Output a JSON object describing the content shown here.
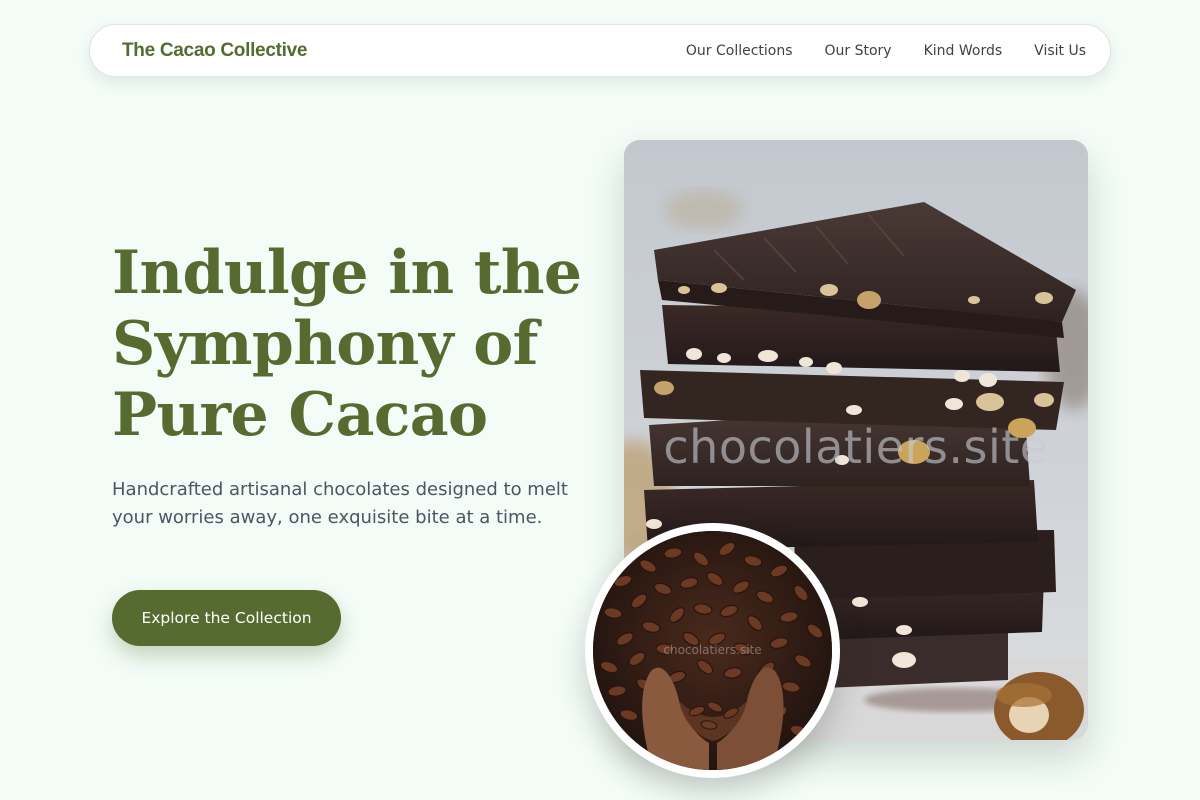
{
  "nav": {
    "brand": "The Cacao Collective",
    "links": [
      "Our Collections",
      "Our Story",
      "Kind Words",
      "Visit Us"
    ]
  },
  "hero": {
    "title_lines": [
      "Indulge in the",
      "Symphony of",
      "Pure Cacao"
    ],
    "subtitle": "Handcrafted artisanal chocolates designed to melt your worries away, one exquisite bite at a time.",
    "cta_label": "Explore the Collection"
  },
  "images": {
    "main_watermark": "chocolatiers.site",
    "circle_watermark": "chocolatiers.site"
  },
  "colors": {
    "brand": "#556b2f",
    "background": "#f3fcf7",
    "text": "#4c5560"
  }
}
